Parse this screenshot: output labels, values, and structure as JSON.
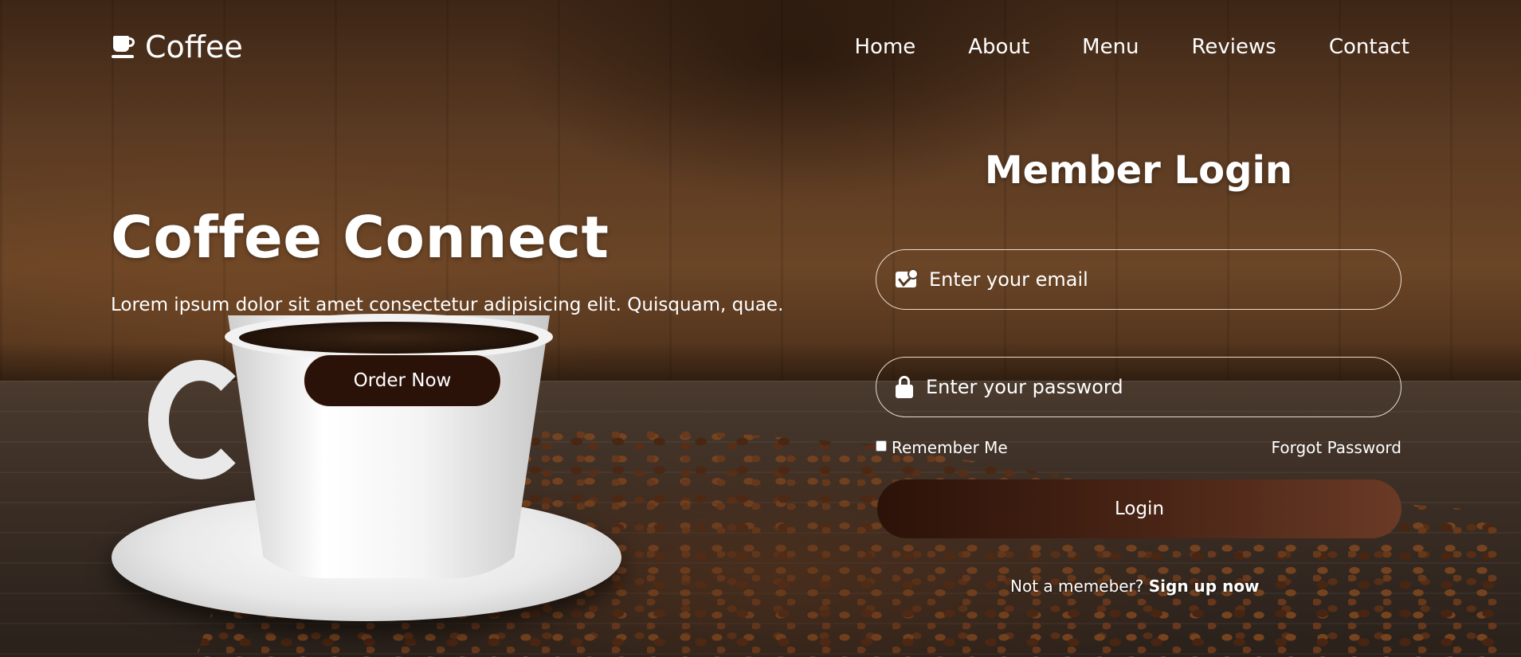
{
  "brand": {
    "name": "Coffee",
    "icon": "coffee-cup-icon"
  },
  "nav": {
    "items": [
      "Home",
      "About",
      "Menu",
      "Reviews",
      "Contact"
    ]
  },
  "hero": {
    "title": "Coffee Connect",
    "subtitle": "Lorem ipsum dolor sit amet consectetur adipisicing elit. Quisquam, quae.",
    "cta_label": "Order Now"
  },
  "login": {
    "title": "Member Login",
    "email_placeholder": "Enter your email",
    "email_icon": "envelope-icon",
    "password_placeholder": "Enter your password",
    "password_icon": "lock-icon",
    "remember_label": "Remember Me",
    "forgot_label": "Forgot Password",
    "submit_label": "Login",
    "signup_prompt": "Not a memeber?",
    "signup_link": "Sign up now"
  },
  "colors": {
    "button_dark": "#2a1209",
    "login_gradient_start": "#2c1209",
    "login_gradient_end": "#6a3a26",
    "text": "#ffffff"
  }
}
